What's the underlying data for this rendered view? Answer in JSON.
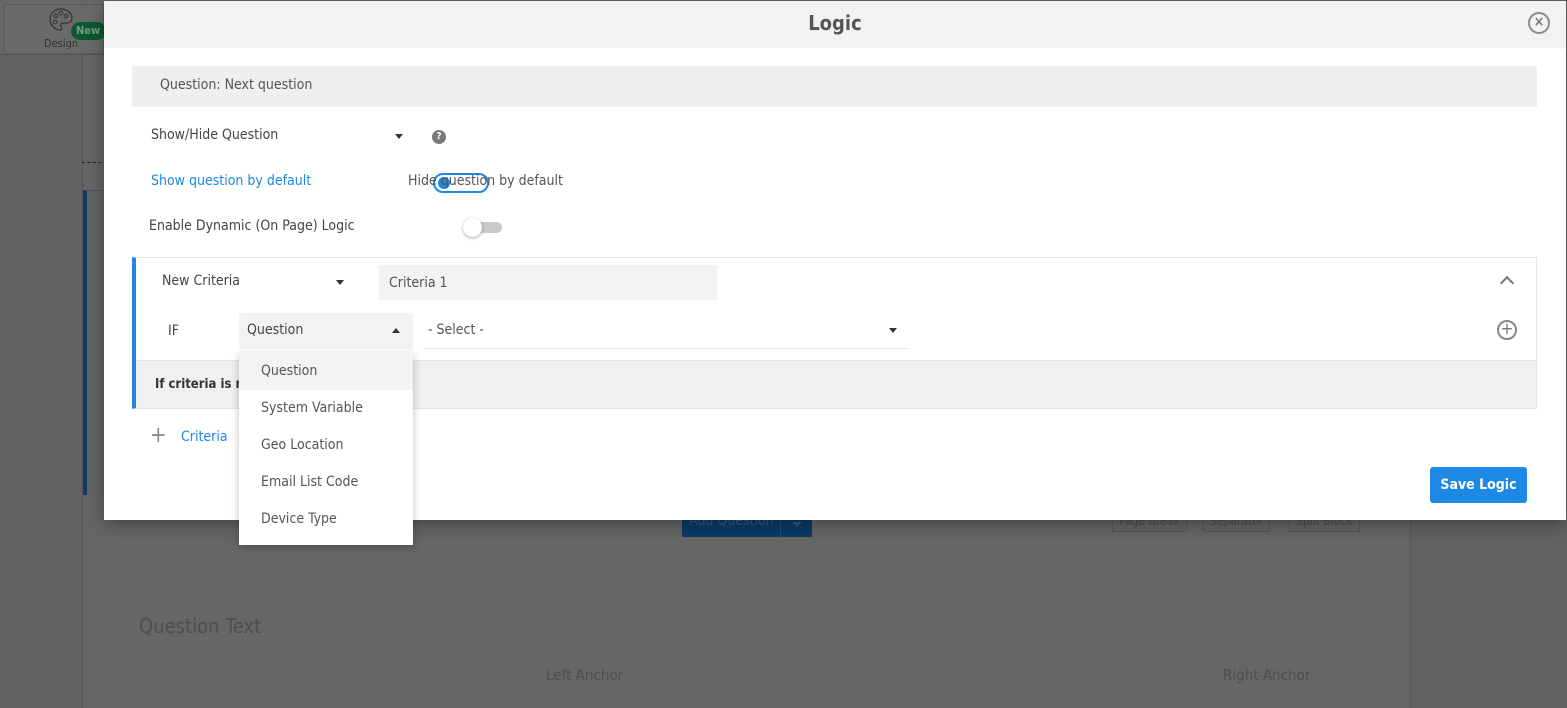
{
  "background": {
    "design_tab": {
      "label": "Design",
      "badge": "New",
      "icon": "palette-icon"
    },
    "add_question_label": "Add Question",
    "tools": [
      "Page Break",
      "Separator",
      "Split Block"
    ],
    "question_text": "Question Text",
    "left_anchor": "Left Anchor",
    "right_anchor": "Right Anchor"
  },
  "modal": {
    "title": "Logic",
    "close_icon": "×",
    "question_label": "Question: Next question",
    "rule_type": "Show/Hide Question",
    "help_icon": "?",
    "show_default_label": "Show question by default",
    "hide_default_label": "Hide question by default",
    "show_by_default": true,
    "dynamic_logic_label": "Enable Dynamic (On Page) Logic",
    "dynamic_logic_enabled": false,
    "criteria": {
      "type_select": "New Criteria",
      "name_value": "Criteria 1",
      "if_label": "IF",
      "source_select": "Question",
      "value_select": "- Select -",
      "add_condition_icon": "+",
      "footer_text": "If criteria is m"
    },
    "add_criteria_plus": "+",
    "add_criteria_label": "Criteria",
    "save_button": "Save Logic"
  },
  "dropdown": {
    "items": [
      {
        "label": "Question",
        "active": true
      },
      {
        "label": "System Variable",
        "active": false
      },
      {
        "label": "Geo Location",
        "active": false
      },
      {
        "label": "Email List Code",
        "active": false
      },
      {
        "label": "Device Type",
        "active": false
      }
    ]
  },
  "colors": {
    "accent": "#1e88e5",
    "overlay": "#626262",
    "badge": "#0c5a31"
  }
}
